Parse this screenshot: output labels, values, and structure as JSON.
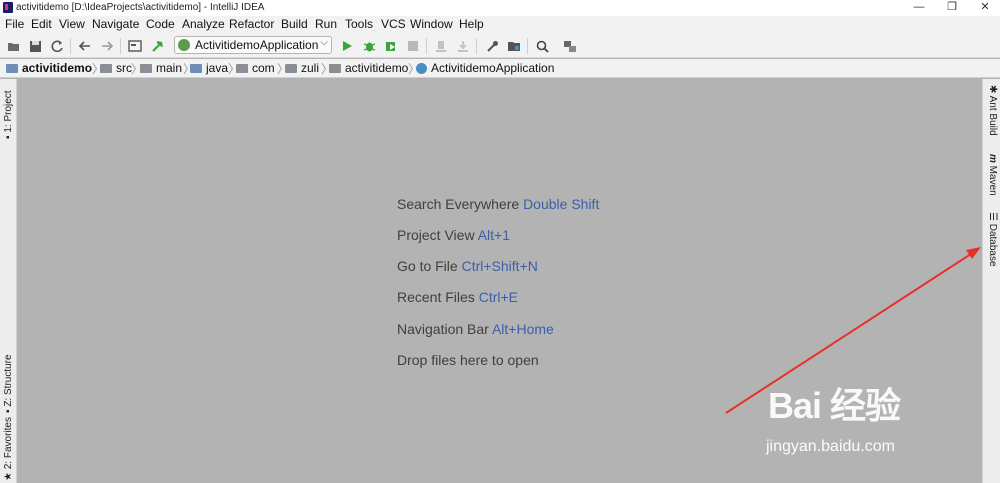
{
  "window": {
    "title": "activitidemo [D:\\IdeaProjects\\activitidemo] - IntelliJ IDEA",
    "controls": {
      "minimize": "—",
      "maximize": "❐",
      "close": "✕"
    }
  },
  "menu": [
    "File",
    "Edit",
    "View",
    "Navigate",
    "Code",
    "Analyze",
    "Refactor",
    "Build",
    "Run",
    "Tools",
    "VCS",
    "Window",
    "Help"
  ],
  "toolbar": {
    "run_config": "ActivitidemoApplication",
    "icons": [
      "open-icon",
      "save-icon",
      "sync-icon",
      "back-icon",
      "forward-icon",
      "project-structure-icon",
      "build-hammer-icon",
      "run-icon",
      "debug-icon",
      "coverage-icon",
      "stop-icon",
      "vcs-update-icon",
      "vcs-commit-icon",
      "settings-wrench-icon",
      "sdk-icon",
      "search-icon",
      "structure-icon"
    ]
  },
  "breadcrumbs": [
    "activitidemo",
    "src",
    "main",
    "java",
    "com",
    "zuli",
    "activitidemo",
    "ActivitidemoApplication"
  ],
  "left_tool_windows": [
    "1: Project",
    "Z: Structure",
    "2: Favorites"
  ],
  "right_tool_windows": [
    "Ant Build",
    "Maven",
    "Database"
  ],
  "editor_hints": [
    {
      "text": "Search Everywhere",
      "shortcut": "Double Shift"
    },
    {
      "text": "Project View",
      "shortcut": "Alt+1"
    },
    {
      "text": "Go to File",
      "shortcut": "Ctrl+Shift+N"
    },
    {
      "text": "Recent Files",
      "shortcut": "Ctrl+E"
    },
    {
      "text": "Navigation Bar",
      "shortcut": "Alt+Home"
    },
    {
      "text": "Drop files here to open",
      "shortcut": ""
    }
  ],
  "watermark": {
    "logo": "Bai 经验",
    "url": "jingyan.baidu.com"
  },
  "colors": {
    "accent_shortcut": "#3b5fa8",
    "editor_bg": "#b3b3b3",
    "arrow": "#e8302a",
    "run_green": "#3aa53a"
  }
}
